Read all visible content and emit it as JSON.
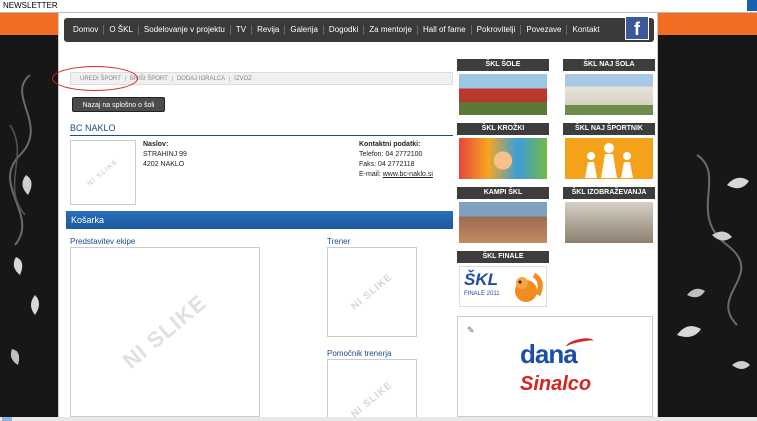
{
  "topbar": {
    "newsletter_label": "NEWSLETTER"
  },
  "nav": {
    "items": [
      "Domov",
      "O ŠKL",
      "Sodelovanje v projektu",
      "TV",
      "Revija",
      "Galerija",
      "Dogodki",
      "Za mentorje",
      "Hall of fame",
      "Pokrovitelji",
      "Povezave",
      "Kontakt"
    ],
    "facebook_icon": "facebook-icon"
  },
  "subtabs": [
    "UREDI ŠPORT",
    "BRIŠI ŠPORT",
    "DODAJ IGRALCA",
    "IZVOZ"
  ],
  "back_button": "Nazaj na splošno o šoli",
  "club": {
    "name": "BC NAKLO",
    "logo_placeholder": "NI SLIKE",
    "address_label": "Naslov:",
    "address_line1": "STRAHINJ 99",
    "address_line2": "4202 NAKLO",
    "contact_label": "Kontaktni podatki:",
    "phone": "Telefon: 04 2772100",
    "fax": "Faks: 04 2772118",
    "email_prefix": "E-mail: ",
    "email_link": "www.bc-naklo.si"
  },
  "sport": {
    "name": "Košarka",
    "team_label": "Predstavitev ekipe",
    "coach_label": "Trener",
    "assistant_label": "Pomočnik trenerja",
    "placeholder": "NI SLIKE"
  },
  "cards": [
    {
      "title": "ŠKL ŠOLE"
    },
    {
      "title": "ŠKL NAJ ŠOLA"
    },
    {
      "title": "ŠKL KROŽKI"
    },
    {
      "title": "ŠKL NAJ ŠPORTNIK"
    },
    {
      "title": "KAMPI ŠKL"
    },
    {
      "title": "ŠKL IZOBRAŽEVANJA"
    },
    {
      "title": "ŠKL FINALE",
      "logo_text": "ŠKL",
      "subtitle": "FINALE 2011"
    }
  ],
  "ad": {
    "brand1": "dana",
    "brand2": "Sinalco"
  }
}
